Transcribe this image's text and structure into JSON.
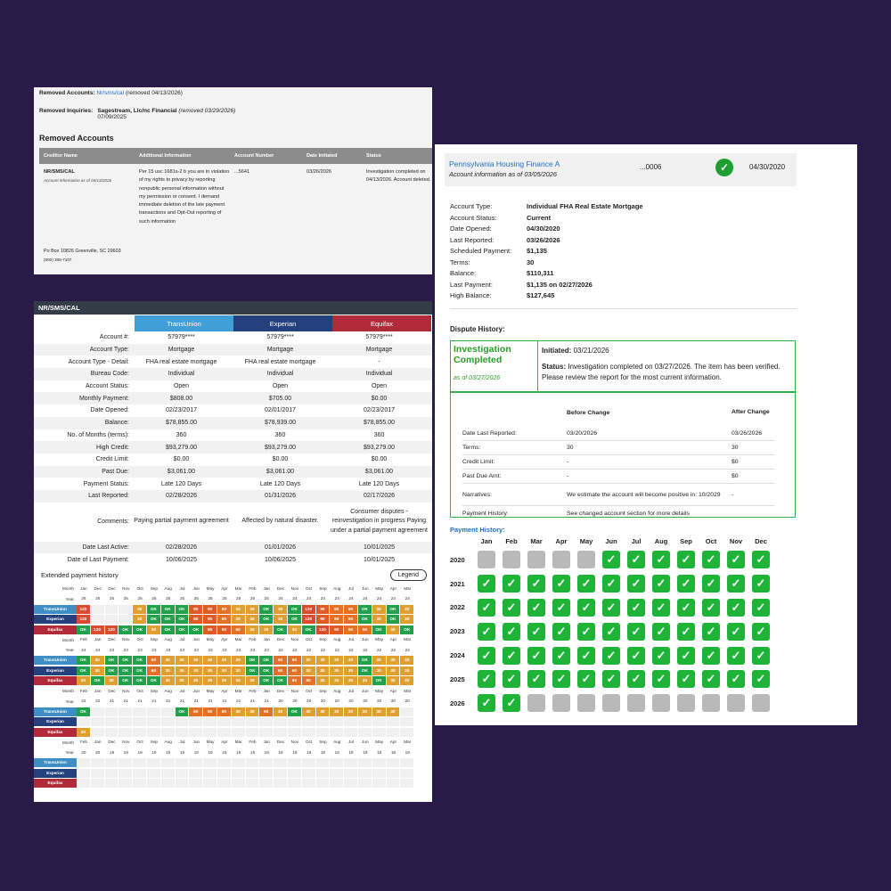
{
  "colors": {
    "transunion": "#3f8fc6",
    "experian": "#24407d",
    "equifax": "#b12a39",
    "ok": "#21a149",
    "late30": "#e0a030",
    "late60": "#e47226",
    "late90": "#e05a25",
    "late120": "#d94c2f",
    "check": "#1fb337",
    "na": "#b9b9b9"
  },
  "removed": {
    "accounts_label": "Removed Accounts:",
    "accounts_value": "Nr/sms/cal",
    "accounts_note": "(removed 04/13/2026)",
    "inquiries_label": "Removed Inquiries:",
    "inquiries_value": "Sagestream, Llc/nc Financial",
    "inquiries_note": "(removed 03/29/2026)",
    "inquiries_date": "07/09/2025",
    "section_title": "Removed Accounts",
    "headers": [
      "Creditor Name",
      "Additional Information",
      "Account Number",
      "Date Initiated",
      "Status"
    ],
    "row": {
      "creditor": "NR/SMS/CAL",
      "creditor_note": "Account information as of 04/13/2026",
      "info": "Per 15 usc 1681s-2 b you are in violation of my rights to privacy by reporting nonpublic personal information without my permission or consent. I demand immediate deletion of the late payment transactions and Opt-Out reporting of such information",
      "number": "...5641",
      "date": "03/26/2026",
      "status": "Investigation completed on 04/13/2026. Account deleted."
    },
    "address": "Po Box 10826 Greenville, SC 29603",
    "phone": "(800) 365-7107"
  },
  "bureau": {
    "title": "NR/SMS/CAL",
    "bureaus": [
      "TransUnion",
      "Experian",
      "Equifax"
    ],
    "rows": [
      {
        "label": "Account #:",
        "v": [
          "57979****",
          "57979****",
          "57979****"
        ]
      },
      {
        "label": "Account Type:",
        "v": [
          "Mortgage",
          "Mortgage",
          "Mortgage"
        ]
      },
      {
        "label": "Account Type - Detail:",
        "v": [
          "FHA real estate mortgage",
          "FHA real estate mortgage",
          "-"
        ]
      },
      {
        "label": "Bureau Code:",
        "v": [
          "Individual",
          "Individual",
          "Individual"
        ]
      },
      {
        "label": "Account Status:",
        "v": [
          "Open",
          "Open",
          "Open"
        ]
      },
      {
        "label": "Monthly Payment:",
        "v": [
          "$808.00",
          "$705.00",
          "$0.00"
        ]
      },
      {
        "label": "Date Opened:",
        "v": [
          "02/23/2017",
          "02/01/2017",
          "02/23/2017"
        ]
      },
      {
        "label": "Balance:",
        "v": [
          "$78,855.00",
          "$78,939.00",
          "$78,855.00"
        ]
      },
      {
        "label": "No. of Months (terms):",
        "v": [
          "360",
          "360",
          "360"
        ]
      },
      {
        "label": "High Credit:",
        "v": [
          "$93,279.00",
          "$93,279.00",
          "$93,279.00"
        ]
      },
      {
        "label": "Credit Limit:",
        "v": [
          "$0.00",
          "$0.00",
          "$0.00"
        ]
      },
      {
        "label": "Past Due:",
        "v": [
          "$3,061.00",
          "$3,061.00",
          "$3,061.00"
        ]
      },
      {
        "label": "Payment Status:",
        "v": [
          "Late 120 Days",
          "Late 120 Days",
          "Late 120 Days"
        ]
      },
      {
        "label": "Last Reported:",
        "v": [
          "02/28/2026",
          "01/31/2026",
          "02/17/2026"
        ]
      }
    ],
    "comments_label": "Comments:",
    "comments": [
      "Paying partial payment agreement",
      "Affected by natural disaster.",
      "Consumer disputes - reinvestigation in progress Paying under a partial payment agreement"
    ],
    "rows2": [
      {
        "label": "Date Last Active:",
        "v": [
          "02/28/2026",
          "01/01/2026",
          "10/01/2025"
        ]
      },
      {
        "label": "Date of Last Payment:",
        "v": [
          "10/06/2025",
          "10/06/2025",
          "10/01/2025"
        ]
      }
    ],
    "ext_label": "Extended payment history",
    "legend_btn": "Legend",
    "month_label": "Month",
    "year_label": "Year",
    "blocks": [
      {
        "months": [
          "Jan",
          "Dec",
          "Dec",
          "Nov",
          "Oct",
          "Sep",
          "Aug",
          "Jul",
          "Jun",
          "May",
          "Apr",
          "Mar",
          "Feb",
          "Jan",
          "Dec",
          "Nov",
          "Oct",
          "Sep",
          "Aug",
          "Jul",
          "Jun",
          "May",
          "Apr",
          "Mar"
        ],
        "years": [
          "26",
          "25",
          "25",
          "25",
          "25",
          "25",
          "25",
          "25",
          "25",
          "25",
          "25",
          "25",
          "25",
          "25",
          "24",
          "24",
          "24",
          "24",
          "24",
          "24",
          "24",
          "24",
          "24",
          "24"
        ],
        "tu": [
          "120",
          "",
          "",
          "",
          "30",
          "OK",
          "OK",
          "OK",
          "90",
          "90",
          "60",
          "30",
          "30",
          "OK",
          "30",
          "OK",
          "120",
          "90",
          "60",
          "60",
          "OK",
          "30",
          "OK",
          "30"
        ],
        "ex": [
          "120",
          "",
          "",
          "",
          "30",
          "OK",
          "OK",
          "OK",
          "90",
          "90",
          "60",
          "30",
          "30",
          "OK",
          "30",
          "OK",
          "120",
          "90",
          "60",
          "60",
          "OK",
          "30",
          "OK",
          "30"
        ],
        "eq": [
          "OK",
          "120",
          "120",
          "OK",
          "OK",
          "30",
          "OK",
          "OK",
          "OK",
          "90",
          "90",
          "60",
          "30",
          "30",
          "OK",
          "30",
          "OK",
          "120",
          "90",
          "60",
          "60",
          "OK",
          "30",
          "OK"
        ]
      },
      {
        "months": [
          "Feb",
          "Jan",
          "Dec",
          "Nov",
          "Oct",
          "Sep",
          "Aug",
          "Jul",
          "Jun",
          "May",
          "Apr",
          "Mar",
          "Feb",
          "Jan",
          "Dec",
          "Nov",
          "Oct",
          "Sep",
          "Aug",
          "Jul",
          "Jun",
          "May",
          "Apr",
          "Mar"
        ],
        "years": [
          "24",
          "24",
          "23",
          "23",
          "23",
          "23",
          "23",
          "23",
          "23",
          "23",
          "23",
          "23",
          "23",
          "23",
          "22",
          "22",
          "22",
          "22",
          "22",
          "22",
          "22",
          "22",
          "22",
          "22"
        ],
        "tu": [
          "OK",
          "30",
          "OK",
          "OK",
          "OK",
          "60",
          "30",
          "30",
          "30",
          "30",
          "30",
          "30",
          "OK",
          "OK",
          "60",
          "60",
          "30",
          "30",
          "30",
          "30",
          "OK",
          "30",
          "30",
          "30"
        ],
        "ex": [
          "OK",
          "30",
          "OK",
          "OK",
          "OK",
          "60",
          "30",
          "30",
          "30",
          "30",
          "30",
          "30",
          "OK",
          "OK",
          "60",
          "60",
          "30",
          "30",
          "30",
          "30",
          "OK",
          "30",
          "30",
          "30"
        ],
        "eq": [
          "30",
          "OK",
          "30",
          "OK",
          "OK",
          "OK",
          "30",
          "30",
          "30",
          "30",
          "30",
          "30",
          "30",
          "OK",
          "OK",
          "60",
          "60",
          "30",
          "30",
          "30",
          "30",
          "OK",
          "30",
          "30"
        ]
      },
      {
        "months": [
          "Feb",
          "Jan",
          "Dec",
          "Nov",
          "Oct",
          "Sep",
          "Aug",
          "Jul",
          "Jun",
          "May",
          "Apr",
          "Mar",
          "Feb",
          "Jan",
          "Dec",
          "Nov",
          "Oct",
          "Sep",
          "Aug",
          "Jul",
          "Jun",
          "May",
          "Apr",
          "Mar"
        ],
        "years": [
          "22",
          "22",
          "21",
          "21",
          "21",
          "21",
          "21",
          "21",
          "21",
          "21",
          "21",
          "21",
          "21",
          "21",
          "20",
          "20",
          "20",
          "20",
          "20",
          "20",
          "20",
          "20",
          "20",
          "20"
        ],
        "tu": [
          "OK",
          "",
          "",
          "",
          "",
          "",
          "",
          "OK",
          "60",
          "60",
          "60",
          "30",
          "30",
          "60",
          "30",
          "OK",
          "30",
          "30",
          "30",
          "30",
          "30",
          "30",
          "30",
          ""
        ],
        "ex": [
          "",
          "",
          "",
          "",
          "",
          "",
          "",
          "",
          "",
          "",
          "",
          "",
          "",
          "",
          "",
          "",
          "",
          "",
          "",
          "",
          "",
          "",
          "",
          ""
        ],
        "eq": [
          "30",
          "",
          "",
          "",
          "",
          "",
          "",
          "",
          "",
          "",
          "",
          "",
          "",
          "",
          "",
          "",
          "",
          "",
          "",
          "",
          "",
          "",
          "",
          ""
        ]
      },
      {
        "months": [
          "Feb",
          "Jan",
          "Dec",
          "Nov",
          "Oct",
          "Sep",
          "Aug",
          "Jul",
          "Jun",
          "May",
          "Apr",
          "Mar",
          "Feb",
          "Jan",
          "Dec",
          "Nov",
          "Oct",
          "Sep",
          "Aug",
          "Jul",
          "Jun",
          "May",
          "Apr",
          "Mar"
        ],
        "years": [
          "20",
          "20",
          "19",
          "19",
          "19",
          "19",
          "19",
          "19",
          "19",
          "19",
          "19",
          "19",
          "19",
          "19",
          "18",
          "18",
          "18",
          "18",
          "18",
          "18",
          "18",
          "18",
          "18",
          "18"
        ],
        "tu": [
          "",
          "",
          "",
          "",
          "",
          "",
          "",
          "",
          "",
          "",
          "",
          "",
          "",
          "",
          "",
          "",
          "",
          "",
          "",
          "",
          "",
          "",
          "",
          ""
        ],
        "ex": [
          "",
          "",
          "",
          "",
          "",
          "",
          "",
          "",
          "",
          "",
          "",
          "",
          "",
          "",
          "",
          "",
          "",
          "",
          "",
          "",
          "",
          "",
          "",
          ""
        ],
        "eq": [
          "",
          "",
          "",
          "",
          "",
          "",
          "",
          "",
          "",
          "",
          "",
          "",
          "",
          "",
          "",
          "",
          "",
          "",
          "",
          "",
          "",
          "",
          "",
          ""
        ]
      }
    ]
  },
  "account": {
    "name": "Pennsylvania Housing Finance A",
    "asof": "Account information as of 03/05/2026",
    "number": "...0006",
    "date": "04/30/2020",
    "details": [
      {
        "k": "Account Type:",
        "v": "Individual FHA Real Estate Mortgage"
      },
      {
        "k": "Account Status:",
        "v": "Current"
      },
      {
        "k": "Date Opened:",
        "v": "04/30/2020"
      },
      {
        "k": "Last Reported:",
        "v": "03/26/2026"
      },
      {
        "k": "Scheduled Payment:",
        "v": "$1,135"
      },
      {
        "k": "Terms:",
        "v": "30"
      },
      {
        "k": "Balance:",
        "v": "$110,311"
      },
      {
        "k": "Last Payment:",
        "v": "$1,135 on 02/27/2026"
      },
      {
        "k": "High Balance:",
        "v": "$127,645"
      }
    ],
    "dispute_title": "Dispute History:",
    "inv_title": "Investigation Completed",
    "inv_date": "as of 03/27/2026",
    "initiated_label": "Initiated:",
    "initiated": "03/21/2026",
    "status_label": "Status:",
    "status": "Investigation completed on 03/27/2026. The item has been verified. Please review the report for the most current information.",
    "change_headers": [
      "",
      "Before Change",
      "After Change"
    ],
    "changes": [
      {
        "a": "Date Last Reported:",
        "b": "03/20/2026",
        "c": "03/26/2026"
      },
      {
        "a": "Terms:",
        "b": "30",
        "c": "30"
      },
      {
        "a": "Credit Limit:",
        "b": "-",
        "c": "$0"
      },
      {
        "a": "Past Due Amt:",
        "b": "-",
        "c": "$0"
      },
      {
        "a": "Narratives:",
        "b": "We estimate the account will become positive in: 10/2029",
        "c": "-"
      },
      {
        "a": "Payment History:",
        "b": "See changed account section for more details",
        "c": ""
      }
    ],
    "pay_title": "Payment History:",
    "months": [
      "Jan",
      "Feb",
      "Mar",
      "Apr",
      "May",
      "Jun",
      "Jul",
      "Aug",
      "Sep",
      "Oct",
      "Nov",
      "Dec"
    ],
    "years": [
      {
        "y": "2020",
        "s": [
          "na",
          "na",
          "na",
          "na",
          "na",
          "ok",
          "ok",
          "ok",
          "ok",
          "ok",
          "ok",
          "ok"
        ]
      },
      {
        "y": "2021",
        "s": [
          "ok",
          "ok",
          "ok",
          "ok",
          "ok",
          "ok",
          "ok",
          "ok",
          "ok",
          "ok",
          "ok",
          "ok"
        ]
      },
      {
        "y": "2022",
        "s": [
          "ok",
          "ok",
          "ok",
          "ok",
          "ok",
          "ok",
          "ok",
          "ok",
          "ok",
          "ok",
          "ok",
          "ok"
        ]
      },
      {
        "y": "2023",
        "s": [
          "ok",
          "ok",
          "ok",
          "ok",
          "ok",
          "ok",
          "ok",
          "ok",
          "ok",
          "ok",
          "ok",
          "ok"
        ]
      },
      {
        "y": "2024",
        "s": [
          "ok",
          "ok",
          "ok",
          "ok",
          "ok",
          "ok",
          "ok",
          "ok",
          "ok",
          "ok",
          "ok",
          "ok"
        ]
      },
      {
        "y": "2025",
        "s": [
          "ok",
          "ok",
          "ok",
          "ok",
          "ok",
          "ok",
          "ok",
          "ok",
          "ok",
          "ok",
          "ok",
          "ok"
        ]
      },
      {
        "y": "2026",
        "s": [
          "ok",
          "ok",
          "na",
          "na",
          "na",
          "na",
          "na",
          "na",
          "na",
          "na",
          "na",
          "na"
        ]
      }
    ]
  }
}
